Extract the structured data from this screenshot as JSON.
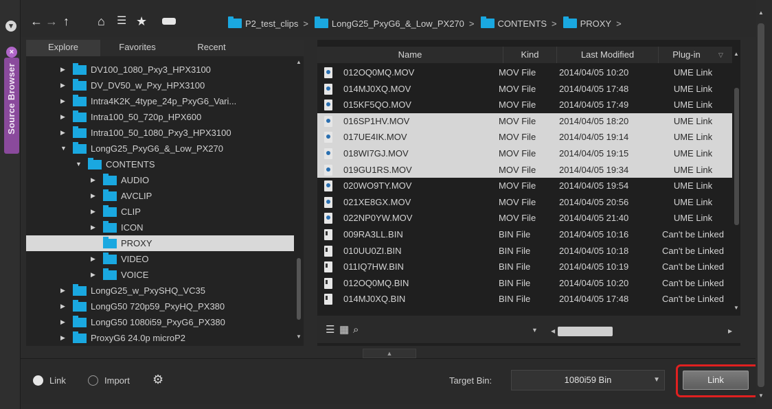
{
  "app": {
    "panel_tab_title": "Source Browser"
  },
  "toolbar": {
    "icons": [
      "back-forward-icon",
      "up-icon",
      "home-icon",
      "tree-view-icon",
      "favorites-star-icon",
      "drive-icon"
    ]
  },
  "breadcrumb": [
    {
      "label": "P2_test_clips"
    },
    {
      "label": "LongG25_PxyG6_&_Low_PX270"
    },
    {
      "label": "CONTENTS"
    },
    {
      "label": "PROXY"
    }
  ],
  "tree_tabs": [
    {
      "label": "Explore",
      "active": true
    },
    {
      "label": "Favorites",
      "active": false
    },
    {
      "label": "Recent",
      "active": false
    }
  ],
  "tree": [
    {
      "label": "DV100_1080_Pxy3_HPX3100",
      "level": 0,
      "expanded": false,
      "selected": false
    },
    {
      "label": "DV_DV50_w_Pxy_HPX3100",
      "level": 0,
      "expanded": false,
      "selected": false
    },
    {
      "label": "Intra4K2K_4type_24p_PxyG6_Vari...",
      "level": 0,
      "expanded": false,
      "selected": false
    },
    {
      "label": "Intra100_50_720p_HPX600",
      "level": 0,
      "expanded": false,
      "selected": false
    },
    {
      "label": "Intra100_50_1080_Pxy3_HPX3100",
      "level": 0,
      "expanded": false,
      "selected": false
    },
    {
      "label": "LongG25_PxyG6_&_Low_PX270",
      "level": 0,
      "expanded": true,
      "selected": false
    },
    {
      "label": "CONTENTS",
      "level": 1,
      "expanded": true,
      "selected": false
    },
    {
      "label": "AUDIO",
      "level": 2,
      "expanded": false,
      "selected": false
    },
    {
      "label": "AVCLIP",
      "level": 2,
      "expanded": false,
      "selected": false
    },
    {
      "label": "CLIP",
      "level": 2,
      "expanded": false,
      "selected": false
    },
    {
      "label": "ICON",
      "level": 2,
      "expanded": false,
      "selected": false
    },
    {
      "label": "PROXY",
      "level": 2,
      "expanded": null,
      "selected": true
    },
    {
      "label": "VIDEO",
      "level": 2,
      "expanded": false,
      "selected": false
    },
    {
      "label": "VOICE",
      "level": 2,
      "expanded": false,
      "selected": false
    },
    {
      "label": "LongG25_w_PxySHQ_VC35",
      "level": 0,
      "expanded": false,
      "selected": false
    },
    {
      "label": "LongG50 720p59_PxyHQ_PX380",
      "level": 0,
      "expanded": false,
      "selected": false
    },
    {
      "label": "LongG50 1080i59_PxyG6_PX380",
      "level": 0,
      "expanded": false,
      "selected": false
    },
    {
      "label": "ProxyG6 24.0p microP2",
      "level": 0,
      "expanded": false,
      "selected": false
    }
  ],
  "file_columns": [
    "Name",
    "Kind",
    "Last Modified",
    "Plug-in"
  ],
  "files": [
    {
      "name": "012OQ0MQ.MOV",
      "kind": "MOV File",
      "modified": "2014/04/05 10:20",
      "plugin": "UME Link",
      "icon": "mov-file-icon",
      "selected": false
    },
    {
      "name": "014MJ0XQ.MOV",
      "kind": "MOV File",
      "modified": "2014/04/05 17:48",
      "plugin": "UME Link",
      "icon": "mov-file-icon",
      "selected": false
    },
    {
      "name": "015KF5QO.MOV",
      "kind": "MOV File",
      "modified": "2014/04/05 17:49",
      "plugin": "UME Link",
      "icon": "mov-file-icon",
      "selected": false
    },
    {
      "name": "016SP1HV.MOV",
      "kind": "MOV File",
      "modified": "2014/04/05 18:20",
      "plugin": "UME Link",
      "icon": "mov-file-icon",
      "selected": true
    },
    {
      "name": "017UE4IK.MOV",
      "kind": "MOV File",
      "modified": "2014/04/05 19:14",
      "plugin": "UME Link",
      "icon": "mov-file-icon",
      "selected": true
    },
    {
      "name": "018WI7GJ.MOV",
      "kind": "MOV File",
      "modified": "2014/04/05 19:15",
      "plugin": "UME Link",
      "icon": "mov-file-icon",
      "selected": true
    },
    {
      "name": "019GU1RS.MOV",
      "kind": "MOV File",
      "modified": "2014/04/05 19:34",
      "plugin": "UME Link",
      "icon": "mov-file-icon",
      "selected": true
    },
    {
      "name": "020WO9TY.MOV",
      "kind": "MOV File",
      "modified": "2014/04/05 19:54",
      "plugin": "UME Link",
      "icon": "mov-file-icon",
      "selected": false
    },
    {
      "name": "021XE8GX.MOV",
      "kind": "MOV File",
      "modified": "2014/04/05 20:56",
      "plugin": "UME Link",
      "icon": "mov-file-icon",
      "selected": false
    },
    {
      "name": "022NP0YW.MOV",
      "kind": "MOV File",
      "modified": "2014/04/05 21:40",
      "plugin": "UME Link",
      "icon": "mov-file-icon",
      "selected": false
    },
    {
      "name": "009RA3LL.BIN",
      "kind": "BIN File",
      "modified": "2014/04/05 10:16",
      "plugin": "Can't be Linked",
      "icon": "bin-file-icon",
      "selected": false
    },
    {
      "name": "010UU0ZI.BIN",
      "kind": "BIN File",
      "modified": "2014/04/05 10:18",
      "plugin": "Can't be Linked",
      "icon": "bin-file-icon",
      "selected": false
    },
    {
      "name": "011IQ7HW.BIN",
      "kind": "BIN File",
      "modified": "2014/04/05 10:19",
      "plugin": "Can't be Linked",
      "icon": "bin-file-icon",
      "selected": false
    },
    {
      "name": "012OQ0MQ.BIN",
      "kind": "BIN File",
      "modified": "2014/04/05 10:20",
      "plugin": "Can't be Linked",
      "icon": "bin-file-icon",
      "selected": false
    },
    {
      "name": "014MJ0XQ.BIN",
      "kind": "BIN File",
      "modified": "2014/04/05 17:48",
      "plugin": "Can't be Linked",
      "icon": "bin-file-icon",
      "selected": false
    }
  ],
  "bottom": {
    "link_radio_label": "Link",
    "import_radio_label": "Import",
    "mode": "Link",
    "target_bin_label": "Target Bin:",
    "target_bin_value": "1080i59 Bin",
    "link_button_label": "Link"
  },
  "colors": {
    "folder": "#1aa8e0",
    "panel_tab": "#8a4a9c",
    "highlight_outline": "#e02020",
    "selection": "#d6d6d6"
  }
}
